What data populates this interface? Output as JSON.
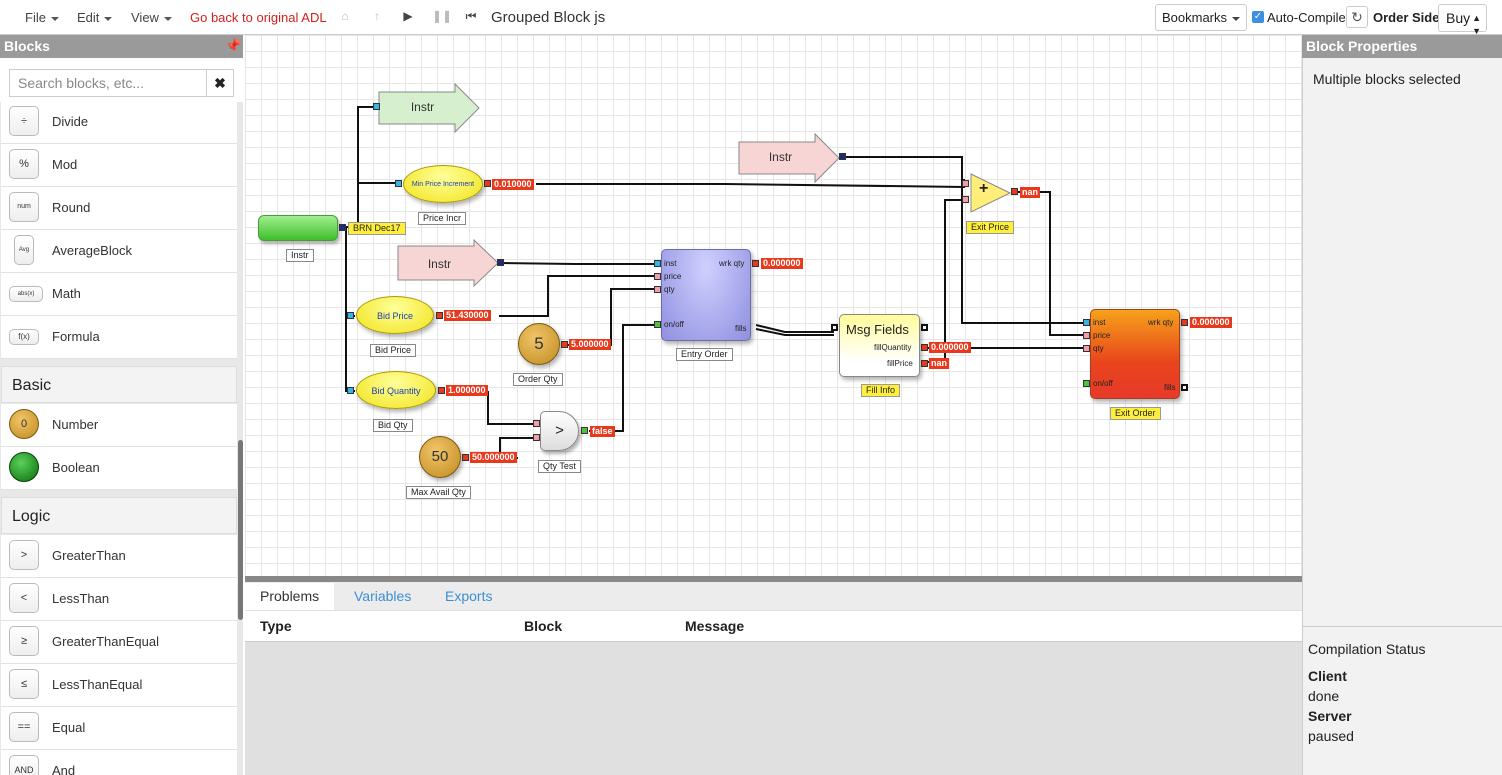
{
  "menu": {
    "file": "File",
    "edit": "Edit",
    "view": "View",
    "go_back": "Go back to original ADL"
  },
  "document_title": "Grouped Block js",
  "toolbar": {
    "bookmarks": "Bookmarks",
    "auto_compile": "Auto-Compile",
    "auto_compile_checked": true,
    "order_side_label": "Order Side",
    "order_side_value": "Buy"
  },
  "sidebar": {
    "title": "Blocks",
    "search_placeholder": "Search blocks, etc...",
    "math_items": [
      {
        "icon": "÷",
        "label": "Divide"
      },
      {
        "icon": "%",
        "label": "Mod"
      },
      {
        "icon": "num",
        "label": "Round"
      },
      {
        "icon": "Avg",
        "label": "AverageBlock"
      },
      {
        "icon": "abs(x)",
        "label": "Math"
      },
      {
        "icon": "f(x)",
        "label": "Formula"
      }
    ],
    "basic_title": "Basic",
    "basic_items": [
      {
        "icon": "0",
        "label": "Number"
      },
      {
        "icon": "",
        "label": "Boolean"
      }
    ],
    "logic_title": "Logic",
    "logic_items": [
      {
        "icon": ">",
        "label": "GreaterThan"
      },
      {
        "icon": "<",
        "label": "LessThan"
      },
      {
        "icon": "≥",
        "label": "GreaterThanEqual"
      },
      {
        "icon": "≤",
        "label": "LessThanEqual"
      },
      {
        "icon": "==",
        "label": "Equal"
      },
      {
        "icon": "AND",
        "label": "And"
      }
    ]
  },
  "diagram": {
    "instr_top": "Instr",
    "instr_source_caption": "Instr",
    "instr_source_value": "BRN Dec17",
    "min_price_inc": "Min Price Increment",
    "min_price_value": "0.010000",
    "price_incr_caption": "Price Incr",
    "instr_mid": "Instr",
    "bid_price": "Bid Price",
    "bid_price_value": "51.430000",
    "bid_price_caption": "Bid Price",
    "bid_qty": "Bid Quantity",
    "bid_qty_value": "1.000000",
    "bid_qty_caption": "Bid Qty",
    "order_qty_number": "5",
    "order_qty_value": "5.000000",
    "order_qty_caption": "Order Qty",
    "max_avail_number": "50",
    "max_avail_value": "50.000000",
    "max_avail_caption": "Max Avail Qty",
    "qty_test_symbol": ">",
    "qty_test_value": "false",
    "qty_test_caption": "Qty Test",
    "entry_order": {
      "inst": "inst",
      "price": "price",
      "qty": "qty",
      "onoff": "on/off",
      "wrk_qty": "wrk qty",
      "wrk_qty_value": "0.000000",
      "fills": "fills",
      "caption": "Entry Order"
    },
    "msg_fields": {
      "title": "Msg Fields",
      "fill_quantity": "fillQuantity",
      "fill_quantity_value": "0.000000",
      "fill_price": "fillPrice",
      "fill_price_value": "nan",
      "caption": "Fill Info"
    },
    "instr_right": "Instr",
    "exit_price": {
      "symbol": "+",
      "value": "nan",
      "caption": "Exit Price"
    },
    "exit_order": {
      "inst": "inst",
      "price": "price",
      "qty": "qty",
      "onoff": "on/off",
      "wrk_qty": "wrk qty",
      "wrk_qty_value": "0.000000",
      "fills": "fills",
      "caption": "Exit Order"
    }
  },
  "bottom": {
    "tabs": [
      "Problems",
      "Variables",
      "Exports"
    ],
    "columns": [
      "Type",
      "Block",
      "Message"
    ]
  },
  "right": {
    "title": "Block Properties",
    "message": "Multiple blocks selected",
    "compilation_title": "Compilation Status",
    "client_label": "Client",
    "client_value": "done",
    "server_label": "Server",
    "server_value": "paused"
  },
  "colors": {
    "accent_red": "#d0211c",
    "link_blue": "#3b8fd6",
    "header_gray": "#9a9a9a"
  }
}
